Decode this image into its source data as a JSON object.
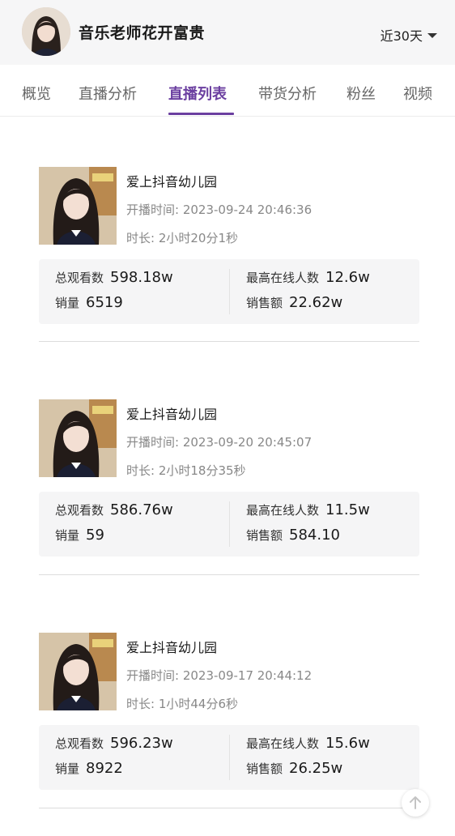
{
  "header": {
    "title": "音乐老师花开富贵",
    "range_label": "近30天"
  },
  "tabs": [
    {
      "label": "概览"
    },
    {
      "label": "直播分析"
    },
    {
      "label": "直播列表"
    },
    {
      "label": "带货分析"
    },
    {
      "label": "粉丝"
    },
    {
      "label": "视频"
    }
  ],
  "active_tab": "直播列表",
  "streams": [
    {
      "title": "爱上抖音幼儿园",
      "start": "开播时间:  2023-09-24 20:46:36",
      "duration": "时长:  2小时20分1秒",
      "views_label": "总观看数",
      "views": "598.18w",
      "peak_label": "最高在线人数",
      "peak": "12.6w",
      "sales_label": "销量",
      "sales": "6519",
      "revenue_label": "销售额",
      "revenue": "22.62w"
    },
    {
      "title": "爱上抖音幼儿园",
      "start": "开播时间:  2023-09-20 20:45:07",
      "duration": "时长:  2小时18分35秒",
      "views_label": "总观看数",
      "views": "586.76w",
      "peak_label": "最高在线人数",
      "peak": "11.5w",
      "sales_label": "销量",
      "sales": "59",
      "revenue_label": "销售额",
      "revenue": "584.10"
    },
    {
      "title": "爱上抖音幼儿园",
      "start": "开播时间:  2023-09-17 20:44:12",
      "duration": "时长:  1小时44分6秒",
      "views_label": "总观看数",
      "views": "596.23w",
      "peak_label": "最高在线人数",
      "peak": "15.6w",
      "sales_label": "销量",
      "sales": "8922",
      "revenue_label": "销售额",
      "revenue": "26.25w"
    }
  ],
  "colors": {
    "accent": "#6b3fa0",
    "header_bg": "#f6f6f7",
    "stat_bg": "#f5f5f6"
  },
  "icons": [
    "profile-avatar",
    "chevron-down-icon",
    "stream-thumbnail",
    "arrow-up-icon"
  ]
}
